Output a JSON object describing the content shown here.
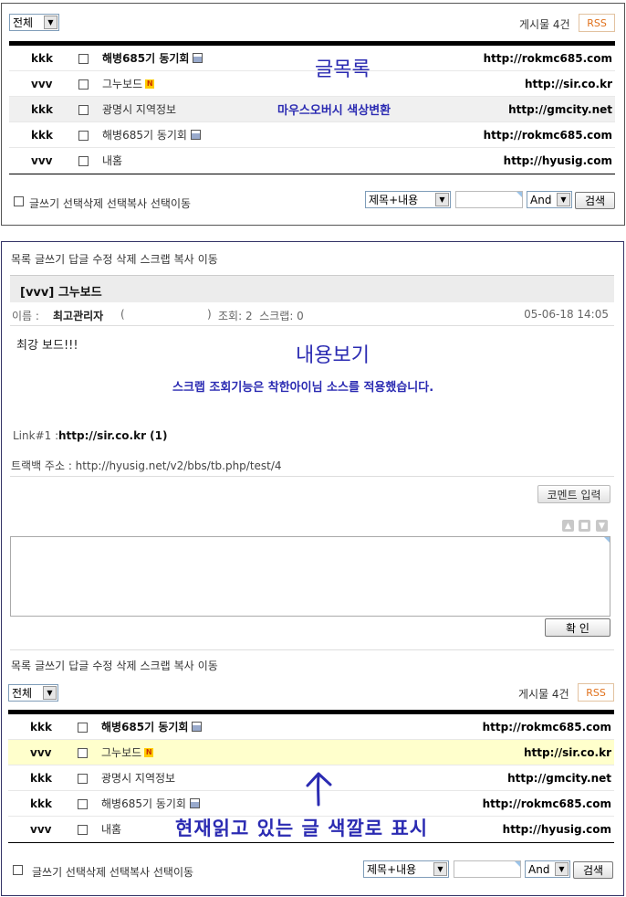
{
  "list_annotation": "글목록",
  "hover_annotation": "마우스오버시 색상변환",
  "view_annotation": "내용보기",
  "scrap_annotation": "스크랩 조회기능은 착한아이님 소스를 적용했습니다.",
  "current_annotation": "현재읽고 있는 글 색깔로 표시",
  "filter": {
    "category": "전체",
    "count_label": "게시물 4건",
    "rss_label": "RSS"
  },
  "rows": [
    {
      "name": "kkk",
      "subject": "해병685기 동기회",
      "url": "http://rokmc685.com"
    },
    {
      "name": "vvv",
      "subject": "그누보드",
      "url": "http://sir.co.kr"
    },
    {
      "name": "kkk",
      "subject": "광명시 지역정보",
      "url": "http://gmcity.net"
    },
    {
      "name": "kkk",
      "subject": "해병685기 동기회",
      "url": "http://rokmc685.com"
    },
    {
      "name": "vvv",
      "subject": "내홈",
      "url": "http://hyusig.com"
    }
  ],
  "new_badge": "N",
  "bottom_actions": {
    "label": "글쓰기 선택삭제 선택복사 선택이동"
  },
  "search": {
    "field": "제목+내용",
    "op": "And",
    "button": "검색"
  },
  "nav_links": [
    "목록",
    "글쓰기",
    "답글",
    "수정",
    "삭제",
    "스크랩",
    "복사",
    "이동"
  ],
  "post": {
    "title": "[vvv] 그누보드",
    "name_label": "이름 :",
    "author": "최고관리자",
    "paren_open": "(",
    "paren_close": ")",
    "meta": "조회: 2  스크랩: 0",
    "date": "05-06-18 14:05",
    "body": "최강 보드!!!",
    "link_label": "Link#1 :",
    "link_value": "http://sir.co.kr (1)",
    "trackback": "트랙백 주소 : http://hyusig.net/v2/bbs/tb.php/test/4"
  },
  "comment": {
    "button": "코멘트 입력",
    "confirm": "확  인"
  }
}
